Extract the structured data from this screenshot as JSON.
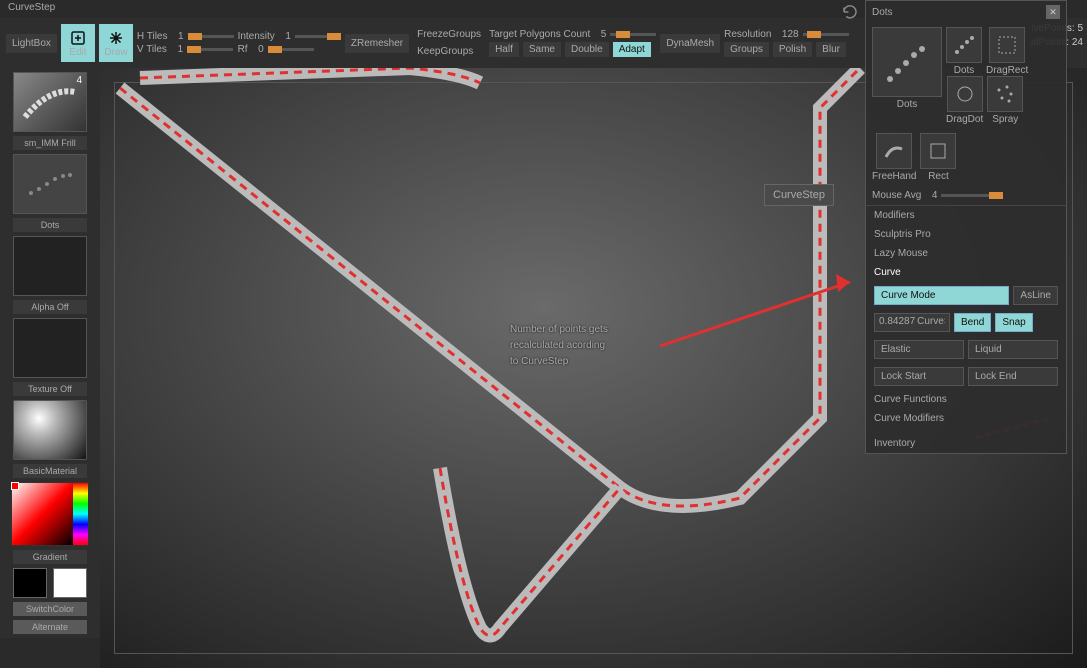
{
  "title": "CurveStep",
  "toolbar": {
    "lightbox": "LightBox",
    "edit": "Edit",
    "draw": "Draw",
    "htiles": {
      "label": "H Tiles",
      "value": "1"
    },
    "vtiles": {
      "label": "V Tiles",
      "value": "1"
    },
    "intensity": {
      "label": "Intensity",
      "value": "1"
    },
    "rf": {
      "label": "Rf",
      "value": "0"
    },
    "zremesher": "ZRemesher",
    "freeze": "FreezeGroups",
    "keep": "KeepGroups",
    "target": {
      "label": "Target Polygons Count",
      "value": "5"
    },
    "half": "Half",
    "same": "Same",
    "double": "Double",
    "adapt": "Adapt",
    "dynamesh": "DynaMesh",
    "resolution": {
      "label": "Resolution",
      "value": "128"
    },
    "groups": "Groups",
    "polish": "Polish",
    "blur": "Blur"
  },
  "left": {
    "brush_value": "4",
    "brush": "sm_IMM Frill",
    "stroke": "Dots",
    "alpha": "Alpha Off",
    "texture": "Texture Off",
    "material": "BasicMaterial",
    "gradient": "Gradient",
    "switch": "SwitchColor",
    "alternate": "Alternate"
  },
  "viewport": {
    "tooltip": "CurveStep",
    "annotation_l1": "Number of points gets",
    "annotation_l2": "recalculated acording",
    "annotation_l3": "to CurveStep"
  },
  "float": {
    "title": "Dots",
    "dots": "Dots",
    "dragrect": "DragRect",
    "dragdot": "DragDot",
    "spray": "Spray",
    "freehand": "FreeHand",
    "rect": "Rect",
    "mouse_avg": {
      "label": "Mouse Avg",
      "value": "4"
    },
    "modifiers": "Modifiers",
    "sculptris": "Sculptris Pro",
    "lazy": "Lazy Mouse",
    "curve": "Curve",
    "curve_mode": "Curve Mode",
    "asline": "AsLine",
    "step_val": "0.84287",
    "step_lbl": "CurveStep",
    "bend": "Bend",
    "snap": "Snap",
    "elastic": "Elastic",
    "liquid": "Liquid",
    "lockstart": "Lock Start",
    "lockend": "Lock End",
    "curve_fn": "Curve Functions",
    "curve_mod": "Curve Modifiers",
    "inventory": "Inventory"
  },
  "info": {
    "active": "ivePoints:",
    "active_v": "5",
    "total": "alPoints:",
    "total_v": "24"
  }
}
